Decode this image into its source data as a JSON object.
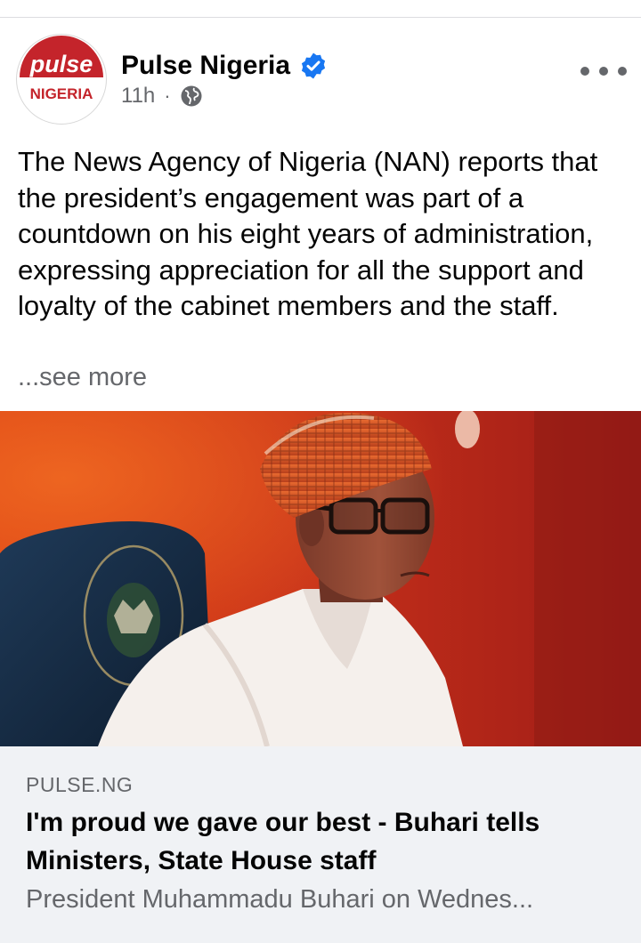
{
  "post": {
    "page_name": "Pulse Nigeria",
    "timestamp": "11h",
    "separator": "·",
    "audience_icon": "globe-icon",
    "verified_icon": "verified-badge-icon",
    "more_icon": "more-options-icon",
    "avatar": {
      "logo_text": "pulse",
      "subtitle": "NIGERIA",
      "brand_color": "#c4242b"
    },
    "text": "The News Agency of Nigeria (NAN) reports that the president’s engagement was part of a countdown on his eight years of administration, expressing appreciation for all the support and loyalty of the cabinet members and the staff.",
    "see_more": "...see more"
  },
  "link_preview": {
    "domain": "PULSE.NG",
    "title": "I'm proud we gave our best - Buhari tells Ministers, State House staff",
    "description": "President Muhammadu Buhari on Wednes..."
  },
  "colors": {
    "verified_blue": "#1877f2",
    "secondary_text": "#65676b",
    "preview_bg": "#f0f2f5"
  }
}
